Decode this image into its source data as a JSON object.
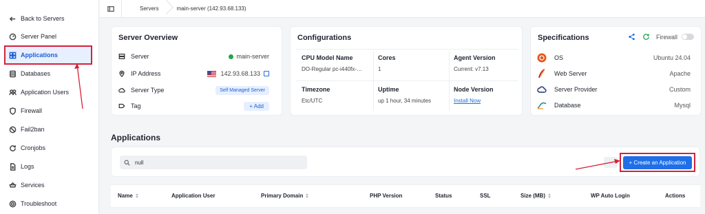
{
  "sidebar": {
    "items": [
      {
        "label": "Back to Servers",
        "icon": "arrow-left-icon"
      },
      {
        "label": "Server Panel",
        "icon": "gauge-icon"
      },
      {
        "label": "Applications",
        "icon": "apps-icon",
        "active": true
      },
      {
        "label": "Databases",
        "icon": "database-icon"
      },
      {
        "label": "Application Users",
        "icon": "users-icon"
      },
      {
        "label": "Firewall",
        "icon": "shield-icon"
      },
      {
        "label": "Fail2ban",
        "icon": "ban-icon"
      },
      {
        "label": "Cronjobs",
        "icon": "refresh-icon"
      },
      {
        "label": "Logs",
        "icon": "file-icon"
      },
      {
        "label": "Services",
        "icon": "services-icon"
      },
      {
        "label": "Troubleshoot",
        "icon": "lifebuoy-icon"
      }
    ]
  },
  "breadcrumb": {
    "servers": "Servers",
    "current": "main-server (142.93.68.133)"
  },
  "overview": {
    "title": "Server Overview",
    "server_label": "Server",
    "server_value": "main-server",
    "ip_label": "IP Address",
    "ip_value": "142.93.68.133",
    "type_label": "Server Type",
    "type_value": "Self Managed Server",
    "tag_label": "Tag",
    "tag_add": "+ Add"
  },
  "configurations": {
    "title": "Configurations",
    "cpu_label": "CPU Model Name",
    "cpu_value": "DO-Regular pc-i440fx-…",
    "cores_label": "Cores",
    "cores_value": "1",
    "agent_label": "Agent Version",
    "agent_value": "Current: v7.13",
    "tz_label": "Timezone",
    "tz_value": "Etc/UTC",
    "uptime_label": "Uptime",
    "uptime_value": "up 1 hour, 34 minutes",
    "node_label": "Node Version",
    "node_value": "Install Now"
  },
  "specifications": {
    "title": "Specifications",
    "firewall_label": "Firewall",
    "os_label": "OS",
    "os_value": "Ubuntu 24.04",
    "web_label": "Web Server",
    "web_value": "Apache",
    "provider_label": "Server Provider",
    "provider_value": "Custom",
    "db_label": "Database",
    "db_value": "Mysql"
  },
  "applications": {
    "title": "Applications",
    "search_value": "null",
    "create_label": "+ Create an Application",
    "columns": [
      "Name",
      "Application User",
      "Primary Domain",
      "PHP Version",
      "Status",
      "SSL",
      "Size (MB)",
      "WP Auto Login",
      "Actions"
    ]
  },
  "colors": {
    "accent": "#1e6fe8",
    "highlight": "#d4213a",
    "online": "#22a64a"
  }
}
